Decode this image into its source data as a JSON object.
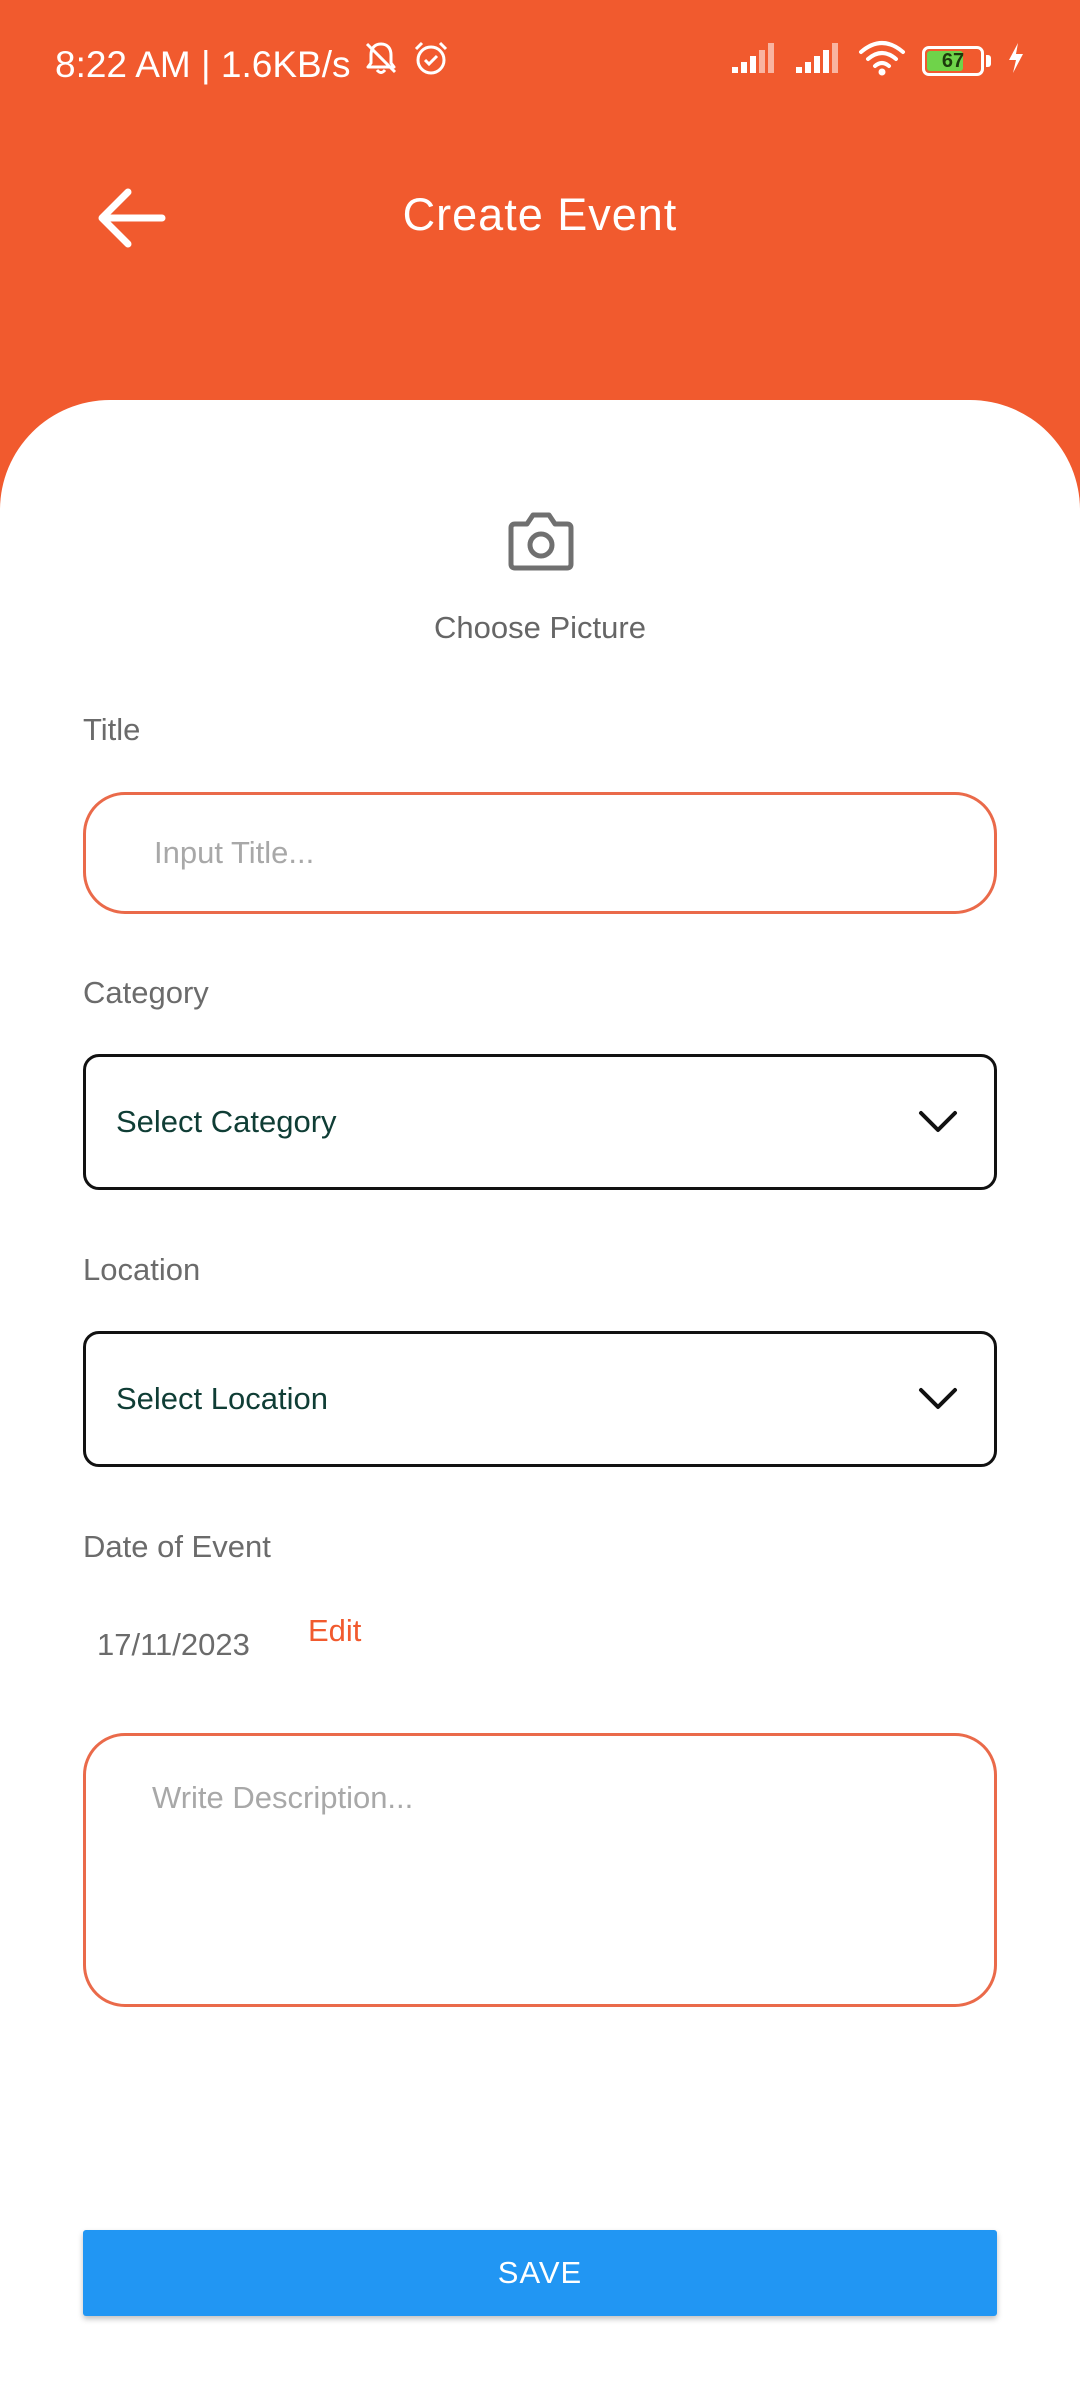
{
  "status_bar": {
    "time_speed": "8:22 AM | 1.6KB/s",
    "battery_level": "67",
    "icons": [
      "bell-off-icon",
      "alarm-icon",
      "signal-icon",
      "signal-icon",
      "wifi-icon",
      "battery-icon",
      "charging-icon"
    ]
  },
  "header": {
    "title": "Create Event",
    "back_icon": "arrow-left-icon"
  },
  "picture": {
    "label": "Choose Picture",
    "icon": "camera-icon"
  },
  "form": {
    "title_label": "Title",
    "title_placeholder": "Input Title...",
    "title_value": "",
    "category_label": "Category",
    "category_value": "Select Category",
    "location_label": "Location",
    "location_value": "Select Location",
    "date_label": "Date of Event",
    "date_value": "17/11/2023",
    "date_edit": "Edit",
    "description_placeholder": "Write Description...",
    "description_value": ""
  },
  "actions": {
    "save_label": "SAVE"
  },
  "colors": {
    "brand": "#f15a2e",
    "accent": "#2196f3",
    "input_border": "#ea6a4a"
  }
}
